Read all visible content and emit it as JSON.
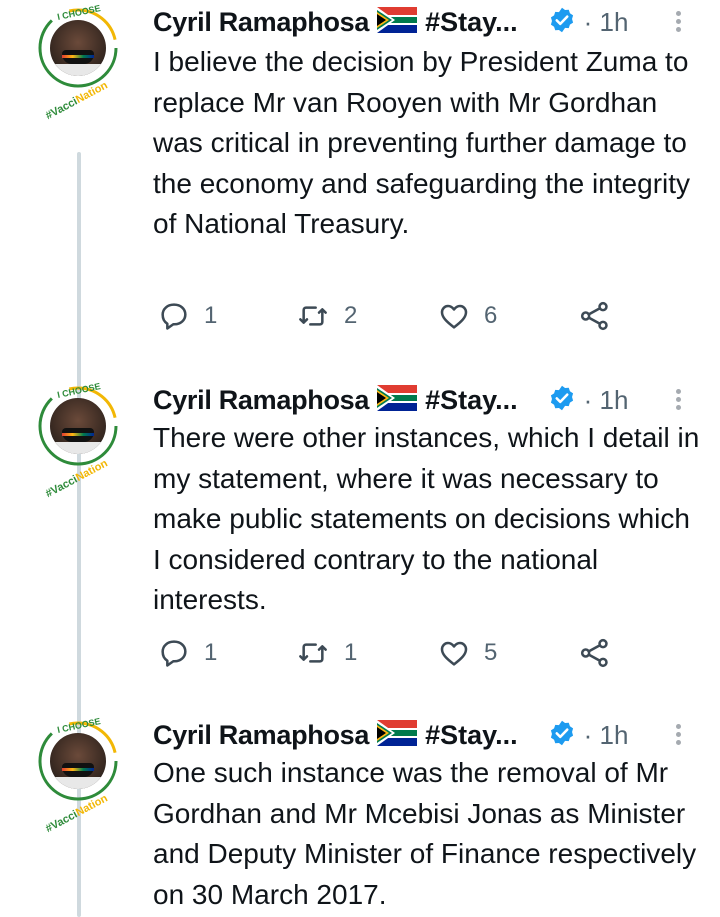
{
  "tweets": [
    {
      "author_name": "Cyril Ramaphosa",
      "handle_suffix": "#Stay...",
      "time": "· 1h",
      "avatar_badge_top": "I CHOOSE",
      "avatar_badge_bottom": "#VacciNation",
      "text": "I believe the decision by President Zuma to replace Mr van Rooyen with Mr Gordhan was critical in preventing further damage to the economy and safeguarding the integrity of National Treasury.",
      "replies": "1",
      "retweets": "2",
      "likes": "6"
    },
    {
      "author_name": "Cyril Ramaphosa",
      "handle_suffix": "#Stay...",
      "time": "· 1h",
      "avatar_badge_top": "I CHOOSE",
      "avatar_badge_bottom": "#VacciNation",
      "text": "There were other instances, which I detail in my statement, where it was necessary to make public statements on decisions which I considered contrary to the national interests.",
      "replies": "1",
      "retweets": "1",
      "likes": "5"
    },
    {
      "author_name": "Cyril Ramaphosa",
      "handle_suffix": "#Stay...",
      "time": "· 1h",
      "avatar_badge_top": "I CHOOSE",
      "avatar_badge_bottom": "#VacciNation",
      "text": "One such instance was the removal of Mr Gordhan and Mr Mcebisi Jonas as Minister and Deputy Minister of Finance respectively on 30 March 2017."
    }
  ],
  "colors": {
    "verified_blue": "#1d9bf0",
    "muted": "#536471",
    "badge_green": "#2e8b3a",
    "badge_yellow": "#f2b705"
  },
  "icons": [
    "reply-icon",
    "retweet-icon",
    "like-icon",
    "share-icon",
    "verified-icon",
    "south-africa-flag-icon",
    "more-icon"
  ]
}
